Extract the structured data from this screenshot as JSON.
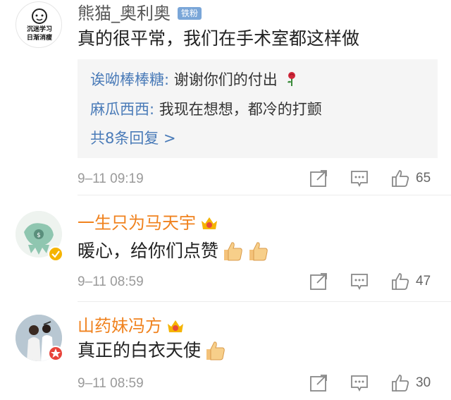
{
  "comments": [
    {
      "username": "熊猫_奥利奥",
      "badge": "铁粉",
      "avatar_text": [
        "沉迷学习",
        "日渐消瘦"
      ],
      "text": "真的很平常，我们在手术室都这样做",
      "replies": [
        {
          "user": "诶呦棒棒糖:",
          "text": " 谢谢你们的付出"
        },
        {
          "user": "麻瓜西西:",
          "text": " 我现在想想，都冷的打颤"
        }
      ],
      "replies_more": "共8条回复 >",
      "time": "9–11 09:19",
      "likes": "65"
    },
    {
      "username": "一生只为马天宇",
      "text": "暖心，给你们点赞",
      "time": "9–11 08:59",
      "likes": "47"
    },
    {
      "username": "山药妹冯方",
      "text": "真正的白衣天使",
      "time": "9–11 08:59",
      "likes": "30"
    }
  ],
  "colors": {
    "username_orange": "#f0821e",
    "username_gray": "#555555",
    "reply_blue": "#4a7bb8",
    "time_gray": "#9a9a9a"
  }
}
